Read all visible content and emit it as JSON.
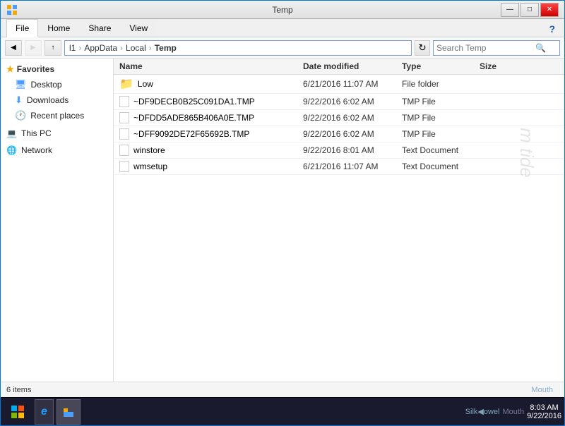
{
  "window": {
    "title": "Temp"
  },
  "titlebar": {
    "minimize": "—",
    "maximize": "□",
    "close": "✕"
  },
  "ribbon": {
    "tabs": [
      "File",
      "Home",
      "Share",
      "View"
    ],
    "active_tab": "Home",
    "help_icon": "?"
  },
  "toolbar": {
    "back_disabled": false,
    "forward_disabled": true,
    "up": "↑"
  },
  "addressbar": {
    "breadcrumbs": [
      "l1",
      "AppData",
      "Local",
      "Temp"
    ],
    "search_placeholder": "Search Temp"
  },
  "columns": {
    "name": "Name",
    "date_modified": "Date modified",
    "type": "Type",
    "size": "Size"
  },
  "files": [
    {
      "name": "Low",
      "date": "6/21/2016 11:07 AM",
      "type": "File folder",
      "size": "",
      "icon": "folder"
    },
    {
      "name": "~DF9DECB0B25C091DA1.TMP",
      "date": "9/22/2016 6:02 AM",
      "type": "TMP File",
      "size": "",
      "icon": "file"
    },
    {
      "name": "~DFDD5ADE865B406A0E.TMP",
      "date": "9/22/2016 6:02 AM",
      "type": "TMP File",
      "size": "",
      "icon": "file"
    },
    {
      "name": "~DFF9092DE72F65692B.TMP",
      "date": "9/22/2016 6:02 AM",
      "type": "TMP File",
      "size": "",
      "icon": "file"
    },
    {
      "name": "winstore",
      "date": "9/22/2016 8:01 AM",
      "type": "Text Document",
      "size": "",
      "icon": "file"
    },
    {
      "name": "wmsetup",
      "date": "6/21/2016 11:07 AM",
      "type": "Text Document",
      "size": "",
      "icon": "file"
    }
  ],
  "nav": {
    "favorites_label": "Favorites",
    "items": [
      {
        "label": "Desktop",
        "icon": "desktop"
      },
      {
        "label": "Downloads",
        "icon": "download"
      },
      {
        "label": "Recent places",
        "icon": "clock"
      }
    ],
    "this_pc_label": "This PC",
    "network_label": "Network"
  },
  "status": {
    "item_count": "6 items",
    "watermark_text": "m tide"
  },
  "taskbar": {
    "start_icon": "⊞",
    "apps": [
      "e",
      "📁"
    ],
    "system_label": "Silk◀owel",
    "time": "8:03 AM",
    "date": "9/22/2016",
    "mouth_label": "Mouth"
  }
}
